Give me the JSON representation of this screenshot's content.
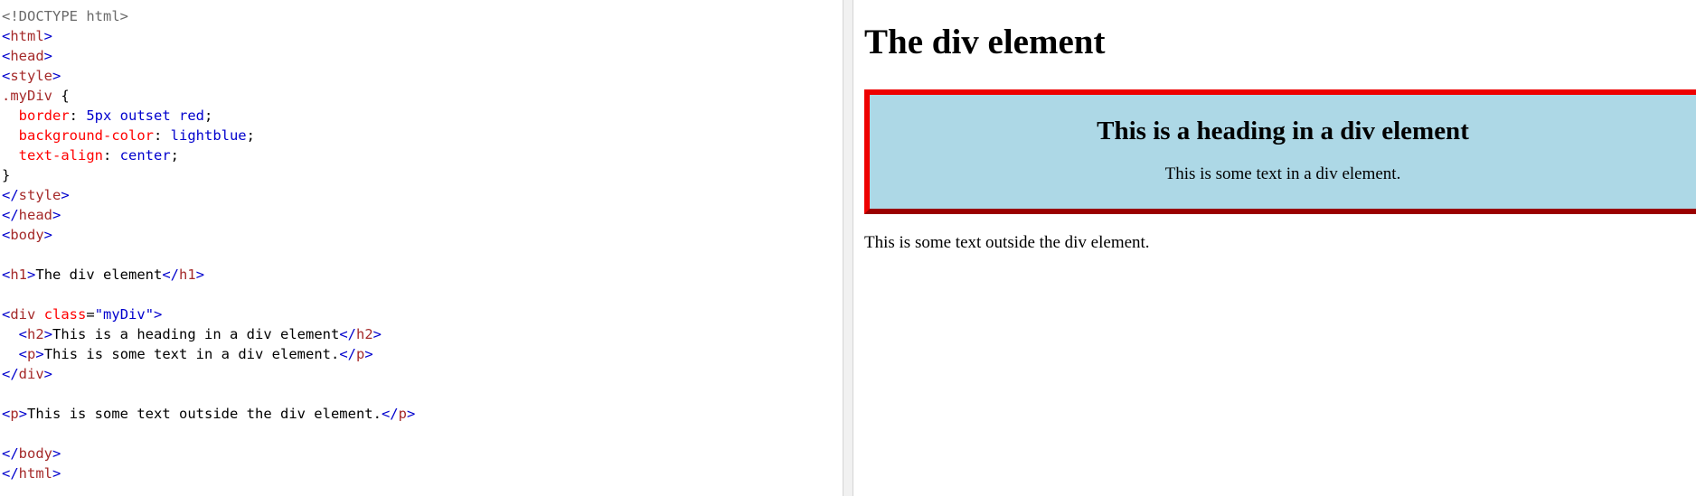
{
  "editor": {
    "lines": [
      [
        {
          "c": "tok-doctype",
          "t": "<!DOCTYPE html>"
        }
      ],
      [
        {
          "c": "tok-bracket",
          "t": "<"
        },
        {
          "c": "tok-tag",
          "t": "html"
        },
        {
          "c": "tok-bracket",
          "t": ">"
        }
      ],
      [
        {
          "c": "tok-bracket",
          "t": "<"
        },
        {
          "c": "tok-tag",
          "t": "head"
        },
        {
          "c": "tok-bracket",
          "t": ">"
        }
      ],
      [
        {
          "c": "tok-bracket",
          "t": "<"
        },
        {
          "c": "tok-tag",
          "t": "style"
        },
        {
          "c": "tok-bracket",
          "t": ">"
        }
      ],
      [
        {
          "c": "tok-selector",
          "t": ".myDiv "
        },
        {
          "c": "tok-punct",
          "t": "{"
        }
      ],
      [
        {
          "c": "tok-text",
          "t": "  "
        },
        {
          "c": "tok-prop",
          "t": "border"
        },
        {
          "c": "tok-punct",
          "t": ": "
        },
        {
          "c": "tok-value",
          "t": "5px outset red"
        },
        {
          "c": "tok-punct",
          "t": ";"
        }
      ],
      [
        {
          "c": "tok-text",
          "t": "  "
        },
        {
          "c": "tok-prop",
          "t": "background-color"
        },
        {
          "c": "tok-punct",
          "t": ": "
        },
        {
          "c": "tok-value",
          "t": "lightblue"
        },
        {
          "c": "tok-punct",
          "t": ";"
        }
      ],
      [
        {
          "c": "tok-text",
          "t": "  "
        },
        {
          "c": "tok-prop",
          "t": "text-align"
        },
        {
          "c": "tok-punct",
          "t": ": "
        },
        {
          "c": "tok-value",
          "t": "center"
        },
        {
          "c": "tok-punct",
          "t": ";"
        }
      ],
      [
        {
          "c": "tok-punct",
          "t": "}"
        }
      ],
      [
        {
          "c": "tok-bracket",
          "t": "</"
        },
        {
          "c": "tok-tag",
          "t": "style"
        },
        {
          "c": "tok-bracket",
          "t": ">"
        }
      ],
      [
        {
          "c": "tok-bracket",
          "t": "</"
        },
        {
          "c": "tok-tag",
          "t": "head"
        },
        {
          "c": "tok-bracket",
          "t": ">"
        }
      ],
      [
        {
          "c": "tok-bracket",
          "t": "<"
        },
        {
          "c": "tok-tag",
          "t": "body"
        },
        {
          "c": "tok-bracket",
          "t": ">"
        }
      ],
      [],
      [
        {
          "c": "tok-bracket",
          "t": "<"
        },
        {
          "c": "tok-tag",
          "t": "h1"
        },
        {
          "c": "tok-bracket",
          "t": ">"
        },
        {
          "c": "tok-text",
          "t": "The div element"
        },
        {
          "c": "tok-bracket",
          "t": "</"
        },
        {
          "c": "tok-tag",
          "t": "h1"
        },
        {
          "c": "tok-bracket",
          "t": ">"
        }
      ],
      [],
      [
        {
          "c": "tok-bracket",
          "t": "<"
        },
        {
          "c": "tok-tag",
          "t": "div"
        },
        {
          "c": "tok-text",
          "t": " "
        },
        {
          "c": "tok-attr",
          "t": "class"
        },
        {
          "c": "tok-punct",
          "t": "="
        },
        {
          "c": "tok-attrval",
          "t": "\"myDiv\""
        },
        {
          "c": "tok-bracket",
          "t": ">"
        }
      ],
      [
        {
          "c": "tok-text",
          "t": "  "
        },
        {
          "c": "tok-bracket",
          "t": "<"
        },
        {
          "c": "tok-tag",
          "t": "h2"
        },
        {
          "c": "tok-bracket",
          "t": ">"
        },
        {
          "c": "tok-text",
          "t": "This is a heading in a div element"
        },
        {
          "c": "tok-bracket",
          "t": "</"
        },
        {
          "c": "tok-tag",
          "t": "h2"
        },
        {
          "c": "tok-bracket",
          "t": ">"
        }
      ],
      [
        {
          "c": "tok-text",
          "t": "  "
        },
        {
          "c": "tok-bracket",
          "t": "<"
        },
        {
          "c": "tok-tag",
          "t": "p"
        },
        {
          "c": "tok-bracket",
          "t": ">"
        },
        {
          "c": "tok-text",
          "t": "This is some text in a div element."
        },
        {
          "c": "tok-bracket",
          "t": "</"
        },
        {
          "c": "tok-tag",
          "t": "p"
        },
        {
          "c": "tok-bracket",
          "t": ">"
        }
      ],
      [
        {
          "c": "tok-bracket",
          "t": "</"
        },
        {
          "c": "tok-tag",
          "t": "div"
        },
        {
          "c": "tok-bracket",
          "t": ">"
        }
      ],
      [],
      [
        {
          "c": "tok-bracket",
          "t": "<"
        },
        {
          "c": "tok-tag",
          "t": "p"
        },
        {
          "c": "tok-bracket",
          "t": ">"
        },
        {
          "c": "tok-text",
          "t": "This is some text outside the div element."
        },
        {
          "c": "tok-bracket",
          "t": "</"
        },
        {
          "c": "tok-tag",
          "t": "p"
        },
        {
          "c": "tok-bracket",
          "t": ">"
        }
      ],
      [],
      [
        {
          "c": "tok-bracket",
          "t": "</"
        },
        {
          "c": "tok-tag",
          "t": "body"
        },
        {
          "c": "tok-bracket",
          "t": ">"
        }
      ],
      [
        {
          "c": "tok-bracket",
          "t": "</"
        },
        {
          "c": "tok-tag",
          "t": "html"
        },
        {
          "c": "tok-bracket",
          "t": ">"
        }
      ]
    ]
  },
  "result": {
    "h1": "The div element",
    "div_heading": "This is a heading in a div element",
    "div_text": "This is some text in a div element.",
    "outside_text": "This is some text outside the div element."
  },
  "colors": {
    "div_background": "#add8e6",
    "div_border": "#ee0000",
    "splitter": "#f1f1f1"
  }
}
